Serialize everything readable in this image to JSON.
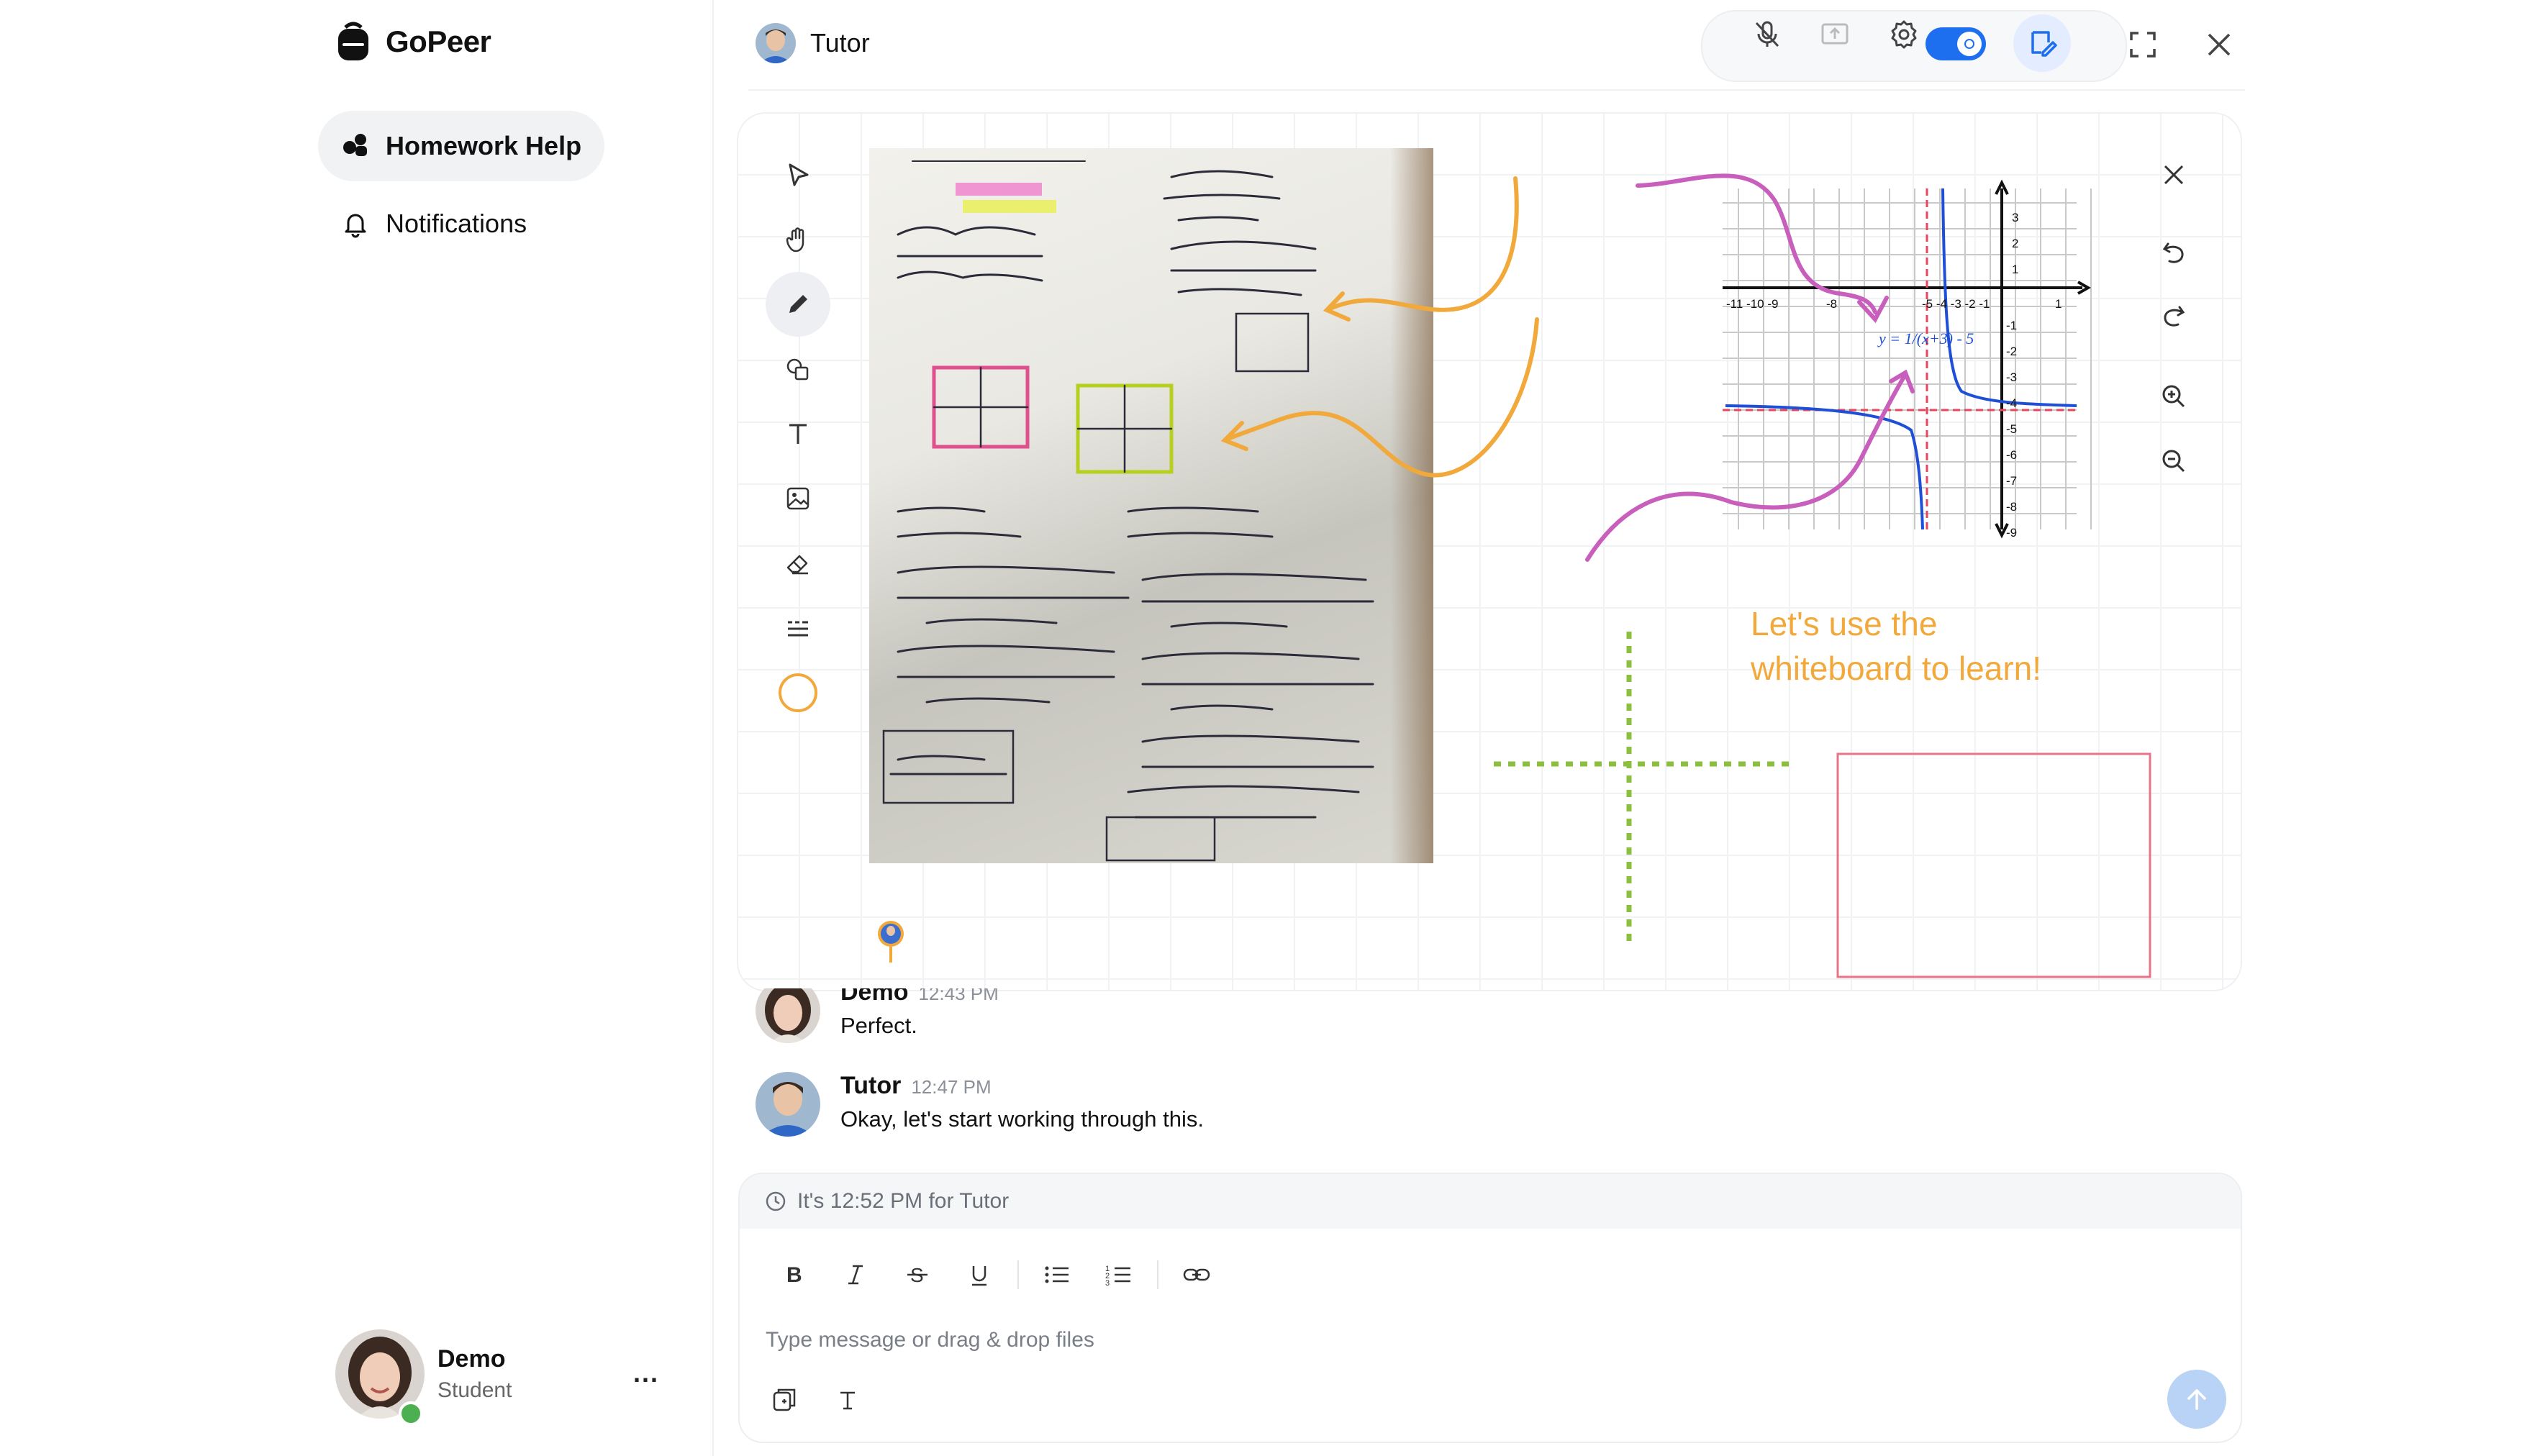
{
  "app": {
    "name": "GoPeer"
  },
  "sidebar": {
    "items": [
      {
        "label": "Homework Help",
        "icon": "chat-bubbles-icon",
        "active": true
      },
      {
        "label": "Notifications",
        "icon": "bell-icon",
        "active": false
      }
    ],
    "profile": {
      "name": "Demo",
      "role": "Student",
      "status": "online",
      "more": "..."
    }
  },
  "header": {
    "title": "Tutor",
    "toolbar": [
      "mic-off-icon",
      "share-screen-icon",
      "settings-icon",
      "toggle-switch",
      "whiteboard-icon",
      "fullscreen-icon",
      "close-icon"
    ],
    "whiteboard_enabled": true
  },
  "whiteboard": {
    "left_tools": [
      "select-arrow-icon",
      "hand-pan-icon",
      "pencil-icon",
      "shapes-icon",
      "text-tool-icon",
      "image-tool-icon",
      "eraser-icon",
      "line-style-icon",
      "color-circle-icon"
    ],
    "active_tool": "pencil-icon",
    "right_tools": [
      "close-icon",
      "undo-icon",
      "redo-icon",
      "zoom-in-icon",
      "zoom-out-icon"
    ],
    "text_note": {
      "line1": "Let's use the",
      "line2": "whiteboard to learn!"
    },
    "graph_label": "y = 1/(x+3) - 5",
    "colors": {
      "orange": "#f2a93b",
      "magenta": "#c85fbd",
      "green": "#8cbf3f",
      "red": "#e8465e",
      "blue": "#1e6ff0"
    }
  },
  "messages": [
    {
      "name": "Demo",
      "time": "12:43 PM",
      "text": "Perfect."
    },
    {
      "name": "Tutor",
      "time": "12:47 PM",
      "text": "Okay, let's start working through this."
    }
  ],
  "composer": {
    "info": "It's 12:52 PM for Tutor",
    "placeholder": "Type message or drag & drop files",
    "format_buttons": [
      "bold-icon",
      "italic-icon",
      "strikethrough-icon",
      "underline-icon",
      "bullet-list-icon",
      "numbered-list-icon",
      "link-icon"
    ],
    "bottom_tools": [
      "attach-file-icon",
      "text-format-icon"
    ],
    "send": "send-arrow-icon"
  }
}
